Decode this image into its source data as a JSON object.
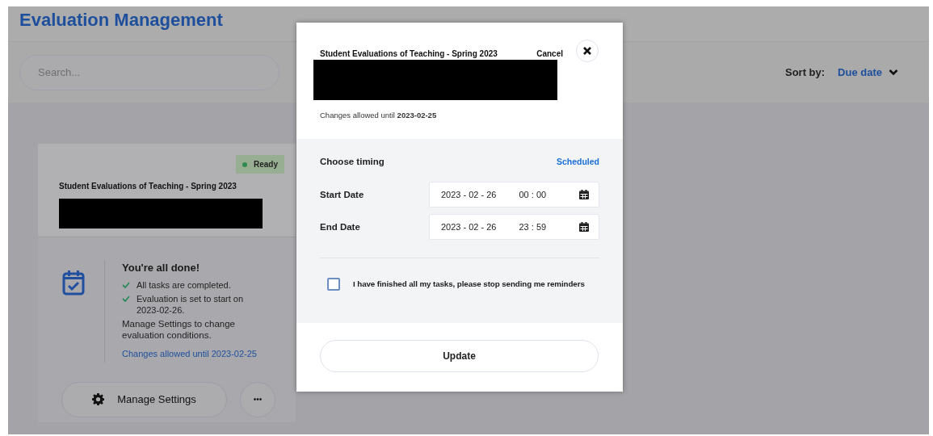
{
  "page": {
    "title": "Evaluation Management"
  },
  "search": {
    "placeholder": "Search..."
  },
  "sort": {
    "label": "Sort by:",
    "value": "Due date"
  },
  "card": {
    "status": "Ready",
    "title": "Student Evaluations of Teaching - Spring 2023",
    "heading": "You're all done!",
    "checks": [
      "All tasks are completed.",
      "Evaluation is set to start on 2023-02-26."
    ],
    "note": "Manage Settings to change evaluation conditions.",
    "link": "Changes allowed until 2023-02-25",
    "manage_button": "Manage Settings",
    "more_button": "•••"
  },
  "modal": {
    "title": "Student Evaluations of Teaching - Spring 2023",
    "cancel": "Cancel",
    "changes": "Changes allowed until **2023-02-25**",
    "timing_label": "Choose timing",
    "timing_value": "Scheduled",
    "dates": [
      {
        "label": "Start Date",
        "date": "2023 - 02 - 26",
        "time": "00 : 00"
      },
      {
        "label": "End Date",
        "date": "2023 - 02 - 26",
        "time": "23 : 59"
      }
    ],
    "reminder": {
      "label": "I have finished all my tasks, please stop sending me reminders",
      "checked": false
    },
    "update_button": "Update"
  }
}
